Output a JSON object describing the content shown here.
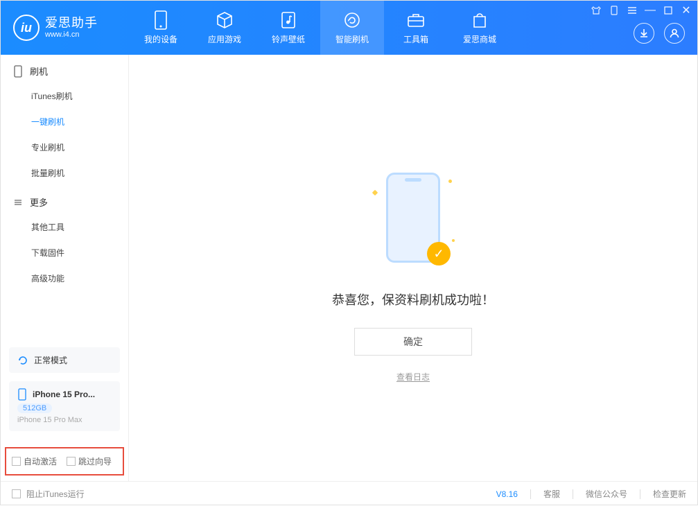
{
  "app": {
    "name_cn": "爱思助手",
    "name_en": "www.i4.cn",
    "version": "V8.16"
  },
  "nav": {
    "items": [
      {
        "label": "我的设备"
      },
      {
        "label": "应用游戏"
      },
      {
        "label": "铃声壁纸"
      },
      {
        "label": "智能刷机"
      },
      {
        "label": "工具箱"
      },
      {
        "label": "爱思商城"
      }
    ]
  },
  "sidebar": {
    "group1_title": "刷机",
    "group1_items": [
      {
        "label": "iTunes刷机"
      },
      {
        "label": "一键刷机"
      },
      {
        "label": "专业刷机"
      },
      {
        "label": "批量刷机"
      }
    ],
    "group2_title": "更多",
    "group2_items": [
      {
        "label": "其他工具"
      },
      {
        "label": "下载固件"
      },
      {
        "label": "高级功能"
      }
    ]
  },
  "mode": {
    "label": "正常模式"
  },
  "device": {
    "name": "iPhone 15 Pro...",
    "storage": "512GB",
    "model": "iPhone 15 Pro Max"
  },
  "options": {
    "auto_activate": "自动激活",
    "skip_wizard": "跳过向导"
  },
  "main": {
    "success_msg": "恭喜您，保资料刷机成功啦！",
    "ok_btn": "确定",
    "view_log": "查看日志"
  },
  "footer": {
    "block_itunes": "阻止iTunes运行",
    "service": "客服",
    "wechat": "微信公众号",
    "update": "检查更新"
  }
}
